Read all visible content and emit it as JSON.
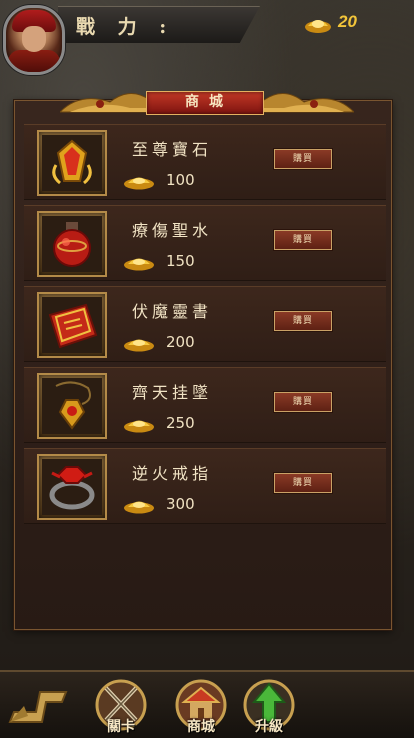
{
  "header": {
    "power_label": "戰 力 :",
    "gold_count": "20"
  },
  "shop": {
    "title": "商城",
    "items": [
      {
        "name": "至尊寶石",
        "price": "100",
        "buy_label": "購買",
        "icon": "gem-icon"
      },
      {
        "name": "療傷聖水",
        "price": "150",
        "buy_label": "購買",
        "icon": "potion-icon"
      },
      {
        "name": "伏魔靈書",
        "price": "200",
        "buy_label": "購買",
        "icon": "book-icon"
      },
      {
        "name": "齊天挂墜",
        "price": "250",
        "buy_label": "購買",
        "icon": "pendant-icon"
      },
      {
        "name": "逆火戒指",
        "price": "300",
        "buy_label": "購買",
        "icon": "ring-icon"
      }
    ]
  },
  "nav": {
    "items": [
      {
        "label": "關卡",
        "icon": "crossed-swords-icon"
      },
      {
        "label": "商城",
        "icon": "shop-icon"
      },
      {
        "label": "升級",
        "icon": "upgrade-arrow-icon"
      }
    ]
  },
  "colors": {
    "gold": "#f2c53a",
    "banner_red": "#c23826",
    "panel_brown": "#3d271c"
  }
}
